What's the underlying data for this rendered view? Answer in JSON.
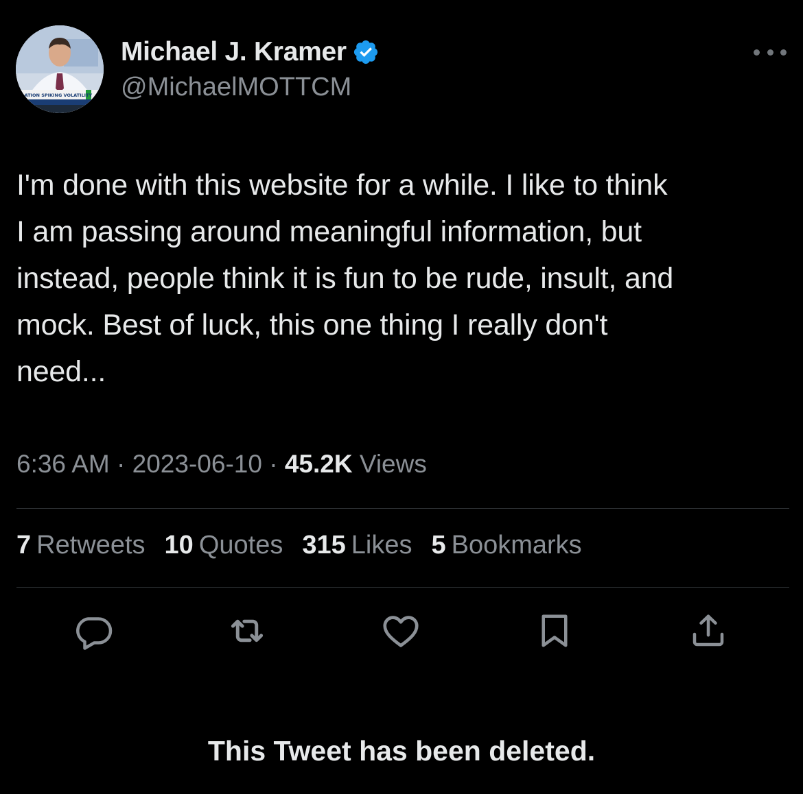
{
  "tweet": {
    "author": {
      "display_name": "Michael J. Kramer",
      "handle": "@MichaelMOTTCM",
      "verified": true,
      "avatar_caption": "FLATION SPIKING VOLATILITY"
    },
    "text": "I'm done with this website for a while. I like to think\nI am passing around meaningful information, but\ninstead, people think it is fun to be rude, insult, and\nmock. Best of luck, this one thing I really don't\nneed...",
    "time": "6:36 AM",
    "date": "2023-06-10",
    "separator": "·",
    "views_count": "45.2K",
    "views_label": "Views"
  },
  "stats": [
    {
      "count": "7",
      "label": "Retweets"
    },
    {
      "count": "10",
      "label": "Quotes"
    },
    {
      "count": "315",
      "label": "Likes"
    },
    {
      "count": "5",
      "label": "Bookmarks"
    }
  ],
  "actions": [
    {
      "icon": "reply-icon"
    },
    {
      "icon": "retweet-icon"
    },
    {
      "icon": "like-icon"
    },
    {
      "icon": "bookmark-icon"
    },
    {
      "icon": "share-icon"
    }
  ],
  "deleted_notice": "This Tweet has been deleted.",
  "colors": {
    "background": "#000000",
    "primary_text": "#e7e9ea",
    "secondary_text": "#8b9096",
    "verified_blue": "#1d9bf0",
    "divider": "#2f3336"
  }
}
